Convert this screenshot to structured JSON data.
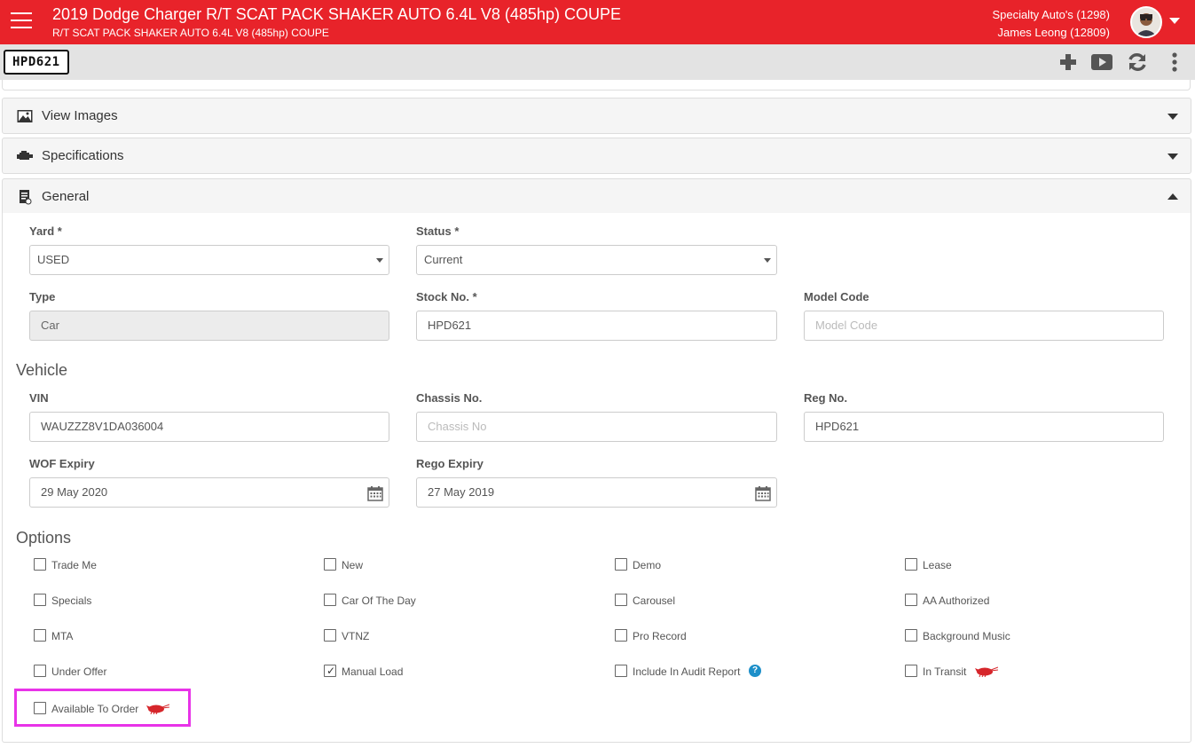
{
  "header": {
    "title": "2019 Dodge Charger R/T SCAT PACK SHAKER AUTO 6.4L V8 (485hp) COUPE",
    "subtitle": "R/T SCAT PACK SHAKER AUTO 6.4L V8 (485hp) COUPE",
    "dealer": "Specialty Auto's (1298)",
    "user": "James Leong (12809)",
    "brand_color": "#e8232a"
  },
  "toolbar": {
    "plate": "HPD621",
    "icons": [
      "plus-icon",
      "video-icon",
      "refresh-icon",
      "more-vert-icon"
    ]
  },
  "accordions": {
    "images": "View Images",
    "specs": "Specifications",
    "general": "General"
  },
  "form": {
    "yard": {
      "label": "Yard *",
      "value": "USED"
    },
    "status": {
      "label": "Status *",
      "value": "Current"
    },
    "type": {
      "label": "Type",
      "value": "Car"
    },
    "stock": {
      "label": "Stock No. *",
      "value": "HPD621"
    },
    "model": {
      "label": "Model Code",
      "placeholder": "Model Code"
    },
    "vehicle_heading": "Vehicle",
    "vin": {
      "label": "VIN",
      "value": "WAUZZZ8V1DA036004"
    },
    "chassis": {
      "label": "Chassis No.",
      "placeholder": "Chassis No"
    },
    "reg": {
      "label": "Reg No.",
      "value": "HPD621"
    },
    "wof": {
      "label": "WOF Expiry",
      "value": "29 May 2020"
    },
    "rego": {
      "label": "Rego Expiry",
      "value": "27 May 2019"
    },
    "options_heading": "Options"
  },
  "options": [
    {
      "label": "Trade Me",
      "checked": false
    },
    {
      "label": "New",
      "checked": false
    },
    {
      "label": "Demo",
      "checked": false
    },
    {
      "label": "Lease",
      "checked": false
    },
    {
      "label": "Specials",
      "checked": false
    },
    {
      "label": "Car Of The Day",
      "checked": false
    },
    {
      "label": "Carousel",
      "checked": false
    },
    {
      "label": "AA Authorized",
      "checked": false
    },
    {
      "label": "MTA",
      "checked": false
    },
    {
      "label": "VTNZ",
      "checked": false
    },
    {
      "label": "Pro Record",
      "checked": false
    },
    {
      "label": "Background Music",
      "checked": false
    },
    {
      "label": "Under Offer",
      "checked": false
    },
    {
      "label": "Manual Load",
      "checked": true
    },
    {
      "label": "Include In Audit Report",
      "checked": false,
      "help": "?"
    },
    {
      "label": "In Transit",
      "checked": false,
      "badge": "shrimp-icon"
    },
    {
      "label": "Available To Order",
      "checked": false,
      "badge": "shrimp-icon"
    }
  ],
  "help_glyph": "?"
}
